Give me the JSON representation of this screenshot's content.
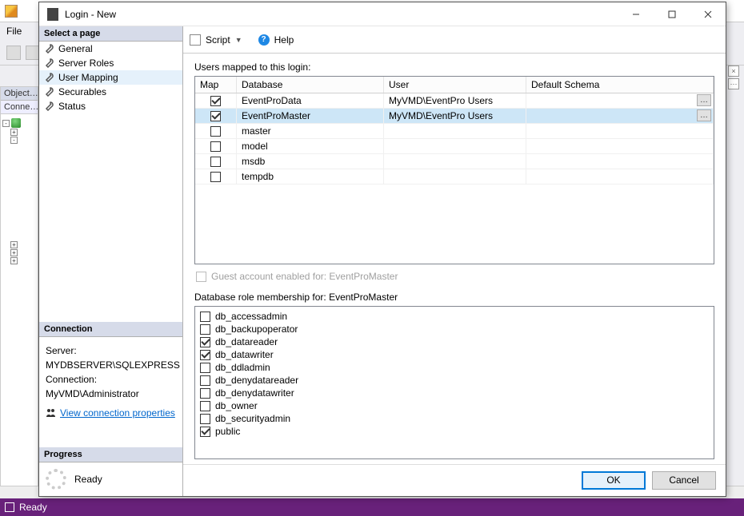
{
  "bg": {
    "file_menu": "File",
    "obj_explorer": "Object…",
    "conn_label": "Conne…",
    "status": "Ready",
    "close_x": "×",
    "dots": "⋯"
  },
  "dialog": {
    "title": "Login - New",
    "toolbar": {
      "script": "Script",
      "help": "Help"
    }
  },
  "pages": {
    "heading": "Select a page",
    "items": [
      {
        "label": "General"
      },
      {
        "label": "Server Roles"
      },
      {
        "label": "User Mapping",
        "selected": true
      },
      {
        "label": "Securables"
      },
      {
        "label": "Status"
      }
    ]
  },
  "connection": {
    "heading": "Connection",
    "server_label": "Server:",
    "server_value": "MYDBSERVER\\SQLEXPRESS",
    "conn_label": "Connection:",
    "conn_value": "MyVMD\\Administrator",
    "link": "View connection properties"
  },
  "progress": {
    "heading": "Progress",
    "status": "Ready"
  },
  "mapping": {
    "label": "Users mapped to this login:",
    "columns": {
      "map": "Map",
      "db": "Database",
      "user": "User",
      "schema": "Default Schema"
    },
    "rows": [
      {
        "checked": true,
        "db": "EventProData",
        "user": "MyVMD\\EventPro Users",
        "schema": "",
        "ellipsis": true,
        "selected": false
      },
      {
        "checked": true,
        "db": "EventProMaster",
        "user": "MyVMD\\EventPro Users",
        "schema": "",
        "ellipsis": true,
        "selected": true
      },
      {
        "checked": false,
        "db": "master",
        "user": "",
        "schema": ""
      },
      {
        "checked": false,
        "db": "model",
        "user": "",
        "schema": ""
      },
      {
        "checked": false,
        "db": "msdb",
        "user": "",
        "schema": ""
      },
      {
        "checked": false,
        "db": "tempdb",
        "user": "",
        "schema": ""
      }
    ],
    "guest_label": "Guest account enabled for: EventProMaster"
  },
  "roles": {
    "label": "Database role membership for: EventProMaster",
    "items": [
      {
        "name": "db_accessadmin",
        "checked": false
      },
      {
        "name": "db_backupoperator",
        "checked": false
      },
      {
        "name": "db_datareader",
        "checked": true
      },
      {
        "name": "db_datawriter",
        "checked": true
      },
      {
        "name": "db_ddladmin",
        "checked": false
      },
      {
        "name": "db_denydatareader",
        "checked": false
      },
      {
        "name": "db_denydatawriter",
        "checked": false
      },
      {
        "name": "db_owner",
        "checked": false
      },
      {
        "name": "db_securityadmin",
        "checked": false
      },
      {
        "name": "public",
        "checked": true
      }
    ]
  },
  "buttons": {
    "ok": "OK",
    "cancel": "Cancel"
  }
}
